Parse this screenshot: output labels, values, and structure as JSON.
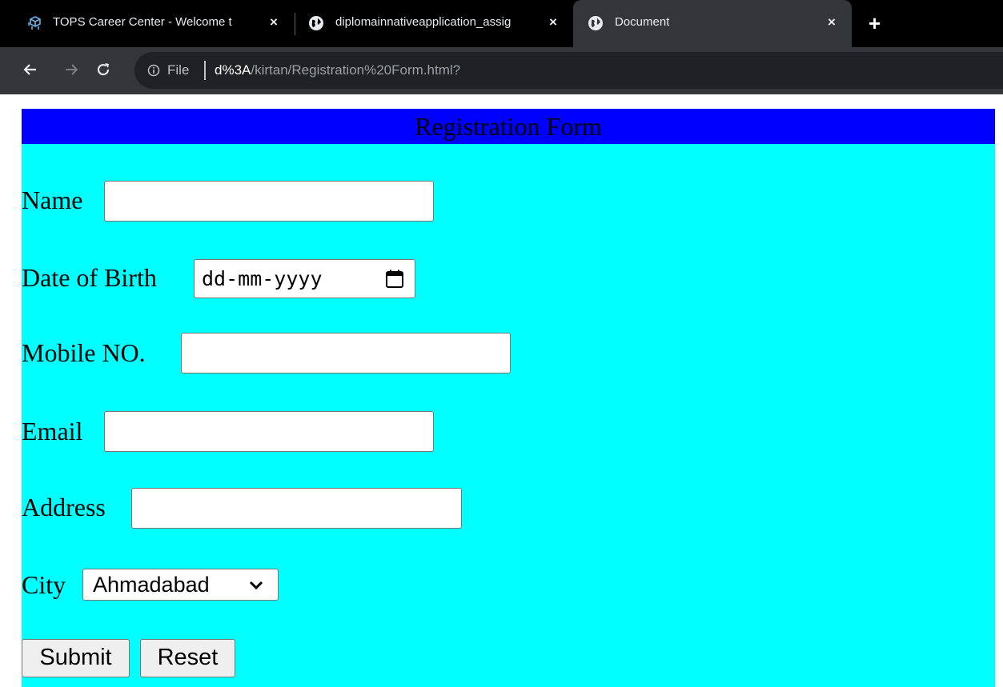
{
  "browser": {
    "tabs": [
      {
        "title": "TOPS Career Center - Welcome t",
        "icon": "tops-logo-icon",
        "close": "×"
      },
      {
        "title": "diplomainnativeapplication_assig",
        "icon": "globe-icon",
        "close": "×"
      },
      {
        "title": "Document",
        "icon": "globe-icon",
        "close": "×",
        "active": true
      }
    ],
    "new_tab": "+",
    "address": {
      "scheme_label": "File",
      "url_host": "d%3A",
      "url_path": "/kirtan/Registration%20Form.html?"
    }
  },
  "form": {
    "title": "Registration Form",
    "header_color": "#0000ff",
    "background_color": "#00ffff",
    "name_label": "Name",
    "name_value": "",
    "dob_label": "Date of Birth",
    "dob_placeholder": "dd-mm-yyyy",
    "mobile_label": "Mobile NO.",
    "mobile_value": "",
    "email_label": "Email",
    "email_value": "",
    "address_label": "Address",
    "address_value": "",
    "city_label": "City",
    "city_selected": "Ahmadabad",
    "submit_label": "Submit",
    "reset_label": "Reset"
  }
}
